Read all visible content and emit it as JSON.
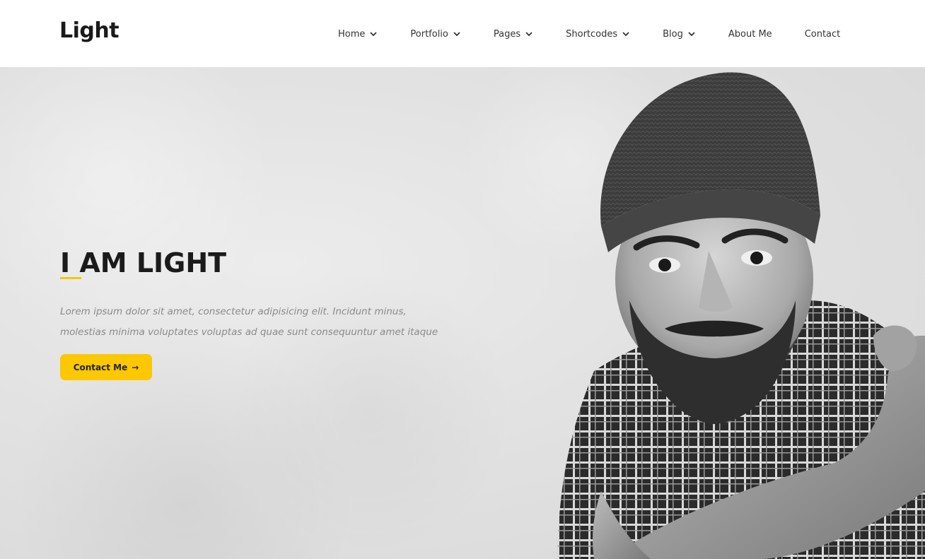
{
  "header": {
    "logo": "Light",
    "nav": [
      {
        "label": "Home",
        "has_dropdown": true
      },
      {
        "label": "Portfolio",
        "has_dropdown": true
      },
      {
        "label": "Pages",
        "has_dropdown": true
      },
      {
        "label": "Shortcodes",
        "has_dropdown": true
      },
      {
        "label": "Blog",
        "has_dropdown": true
      },
      {
        "label": "About Me",
        "has_dropdown": false
      },
      {
        "label": "Contact",
        "has_dropdown": false
      }
    ]
  },
  "hero": {
    "title": "I AM LIGHT",
    "description_lines": [
      "Lorem ipsum dolor sit amet, consectetur adipisicing elit. Incidunt minus,",
      "molestias minima voluptates voluptas ad quae sunt consequuntur amet itaque"
    ],
    "cta_label": "Contact Me",
    "cta_icon": "arrow-right-icon",
    "image_description": "black-and-white portrait of a bearded man in a beanie and plaid shirt"
  },
  "colors": {
    "accent": "#fdc800",
    "title": "#1b1b1b",
    "muted_text": "#8a8a8a",
    "background": "#e4e4e4"
  }
}
